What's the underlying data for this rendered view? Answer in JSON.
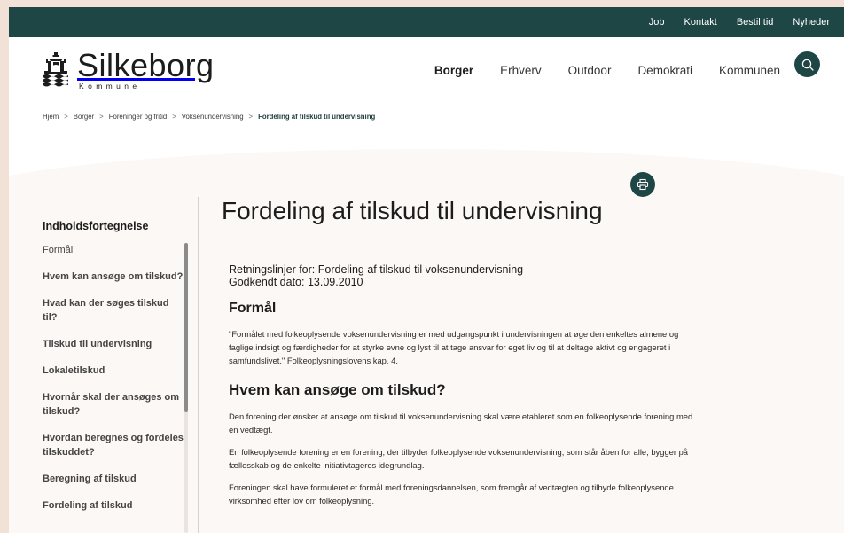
{
  "topbar": {
    "links": [
      "Job",
      "Kontakt",
      "Bestil tid",
      "Nyheder"
    ]
  },
  "brand": {
    "name": "Silkeborg",
    "sub": "Kommune",
    "logo_icon": "crest-icon"
  },
  "nav": {
    "items": [
      "Borger",
      "Erhverv",
      "Outdoor",
      "Demokrati",
      "Kommunen"
    ],
    "active": "Borger",
    "search_icon": "search-icon"
  },
  "breadcrumb": {
    "items": [
      "Hjem",
      "Borger",
      "Foreninger og fritid",
      "Voksenundervisning",
      "Fordeling af tilskud til undervisning"
    ],
    "separator": ">"
  },
  "toc": {
    "title": "Indholdsfortegnelse",
    "items": [
      "Formål",
      "Hvem kan ansøge om tilskud?",
      "Hvad kan der søges tilskud til?",
      "Tilskud til undervisning",
      "Lokaletilskud",
      "Hvornår skal der ansøges om tilskud?",
      "Hvordan beregnes og fordeles tilskuddet?",
      "Beregning af tilskud",
      "Fordeling af tilskud"
    ]
  },
  "article": {
    "print_icon": "print-icon",
    "title": "Fordeling af tilskud til undervisning",
    "meta_line1": "Retningslinjer for: Fordeling af tilskud til voksenundervisning",
    "meta_line2": "Godkendt dato: 13.09.2010",
    "section1_heading": "Formål",
    "section1_p1": "\"Formålet med folkeoplysende voksenundervisning er med udgangspunkt i undervisningen at øge den enkeltes almene og faglige indsigt og færdigheder for at styrke evne og lyst til at tage ansvar for eget liv og til at deltage aktivt og engageret i samfundslivet.\" Folkeoplysningslovens kap. 4.",
    "section2_heading": "Hvem kan ansøge om tilskud?",
    "section2_p1": "Den forening der ønsker at ansøge om tilskud til voksenundervisning skal være etableret som en folkeoplysende forening med en vedtægt.",
    "section2_p2": "En folkeoplysende forening er en forening, der tilbyder folkeoplysende voksenundervisning, som står åben for alle, bygger på fællesskab og de enkelte initiativtageres idegrundlag.",
    "section2_p3": "Foreningen skal have formuleret et formål med foreningsdannelsen, som fremgår af vedtægten og tilbyde folkeoplysende virksomhed efter lov om folkeoplysning."
  },
  "colors": {
    "brand_dark": "#1e4645",
    "page_bg": "#fcf8f5",
    "outer_bg": "#f1e1d6"
  }
}
